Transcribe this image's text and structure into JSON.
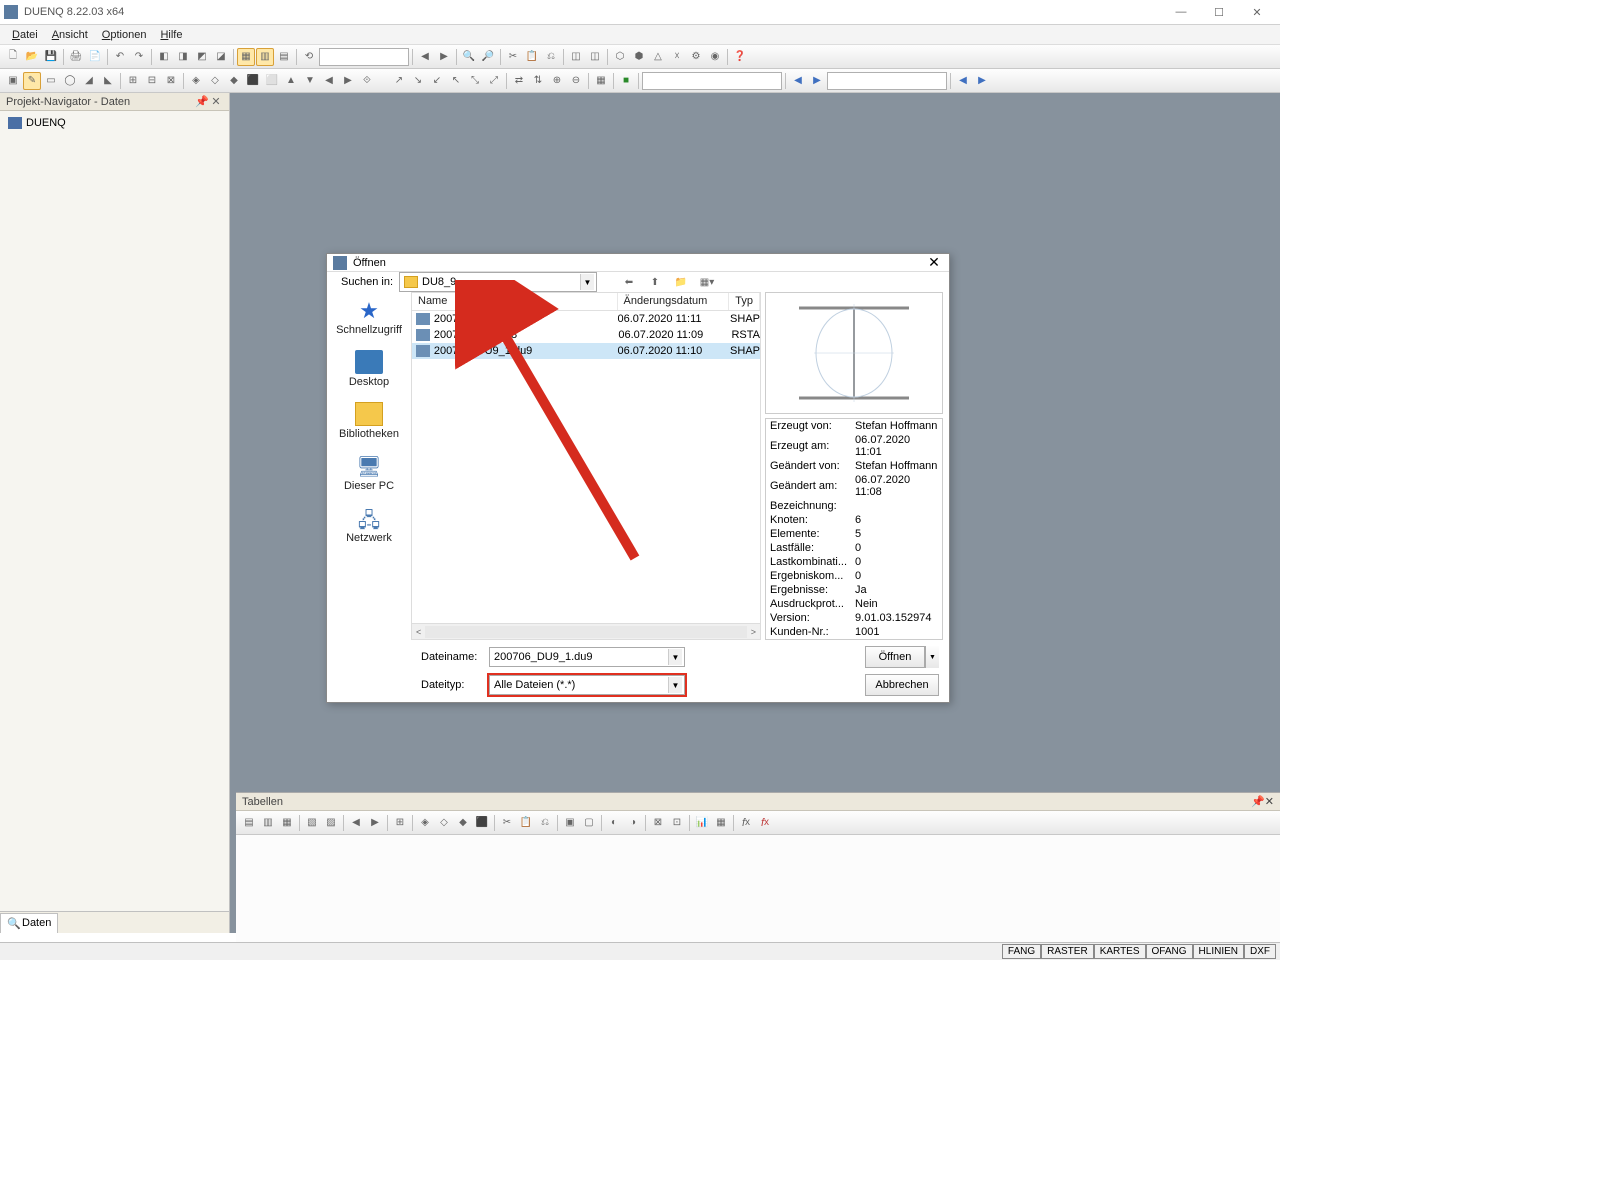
{
  "window": {
    "title": "DUENQ 8.22.03 x64"
  },
  "menu": {
    "items": [
      "Datei",
      "Ansicht",
      "Optionen",
      "Hilfe"
    ]
  },
  "navigator": {
    "title": "Projekt-Navigator - Daten",
    "root": "DUENQ",
    "tab": "Daten"
  },
  "tables": {
    "title": "Tabellen"
  },
  "status": {
    "items": [
      "FANG",
      "RASTER",
      "KARTES",
      "OFANG",
      "HLINIEN",
      "DXF"
    ]
  },
  "dialog": {
    "title": "Öffnen",
    "search_label": "Suchen in:",
    "folder": "DU8_9",
    "columns": {
      "name": "Name",
      "date": "Änderungsdatum",
      "type": "Typ"
    },
    "sidebar": [
      "Schnellzugriff",
      "Desktop",
      "Bibliotheken",
      "Dieser PC",
      "Netzwerk"
    ],
    "files": [
      {
        "name": "200706_DU8_1.du8",
        "date": "06.07.2020 11:11",
        "type": "SHAP"
      },
      {
        "name": "200706_DU9.rs8",
        "date": "06.07.2020 11:09",
        "type": "RSTA"
      },
      {
        "name": "200706_DU9_1.du9",
        "date": "06.07.2020 11:10",
        "type": "SHAP"
      }
    ],
    "filename_label": "Dateiname:",
    "filename": "200706_DU9_1.du9",
    "filetype_label": "Dateityp:",
    "filetype": "Alle Dateien (*.*)",
    "open": "Öffnen",
    "cancel": "Abbrechen",
    "props": [
      [
        "Erzeugt von:",
        "Stefan Hoffmann"
      ],
      [
        "Erzeugt am:",
        "06.07.2020 11:01"
      ],
      [
        "Geändert von:",
        "Stefan Hoffmann"
      ],
      [
        "Geändert am:",
        "06.07.2020 11:08"
      ],
      [
        "Bezeichnung:",
        ""
      ],
      [
        "Knoten:",
        "6"
      ],
      [
        "Elemente:",
        "5"
      ],
      [
        "Lastfälle:",
        "0"
      ],
      [
        "Lastkombinati...",
        "0"
      ],
      [
        "Ergebniskom...",
        "0"
      ],
      [
        "Ergebnisse:",
        "Ja"
      ],
      [
        "Ausdruckprot...",
        "Nein"
      ],
      [
        "Version:",
        "9.01.03.152974"
      ],
      [
        "Kunden-Nr.:",
        "1001"
      ]
    ]
  }
}
